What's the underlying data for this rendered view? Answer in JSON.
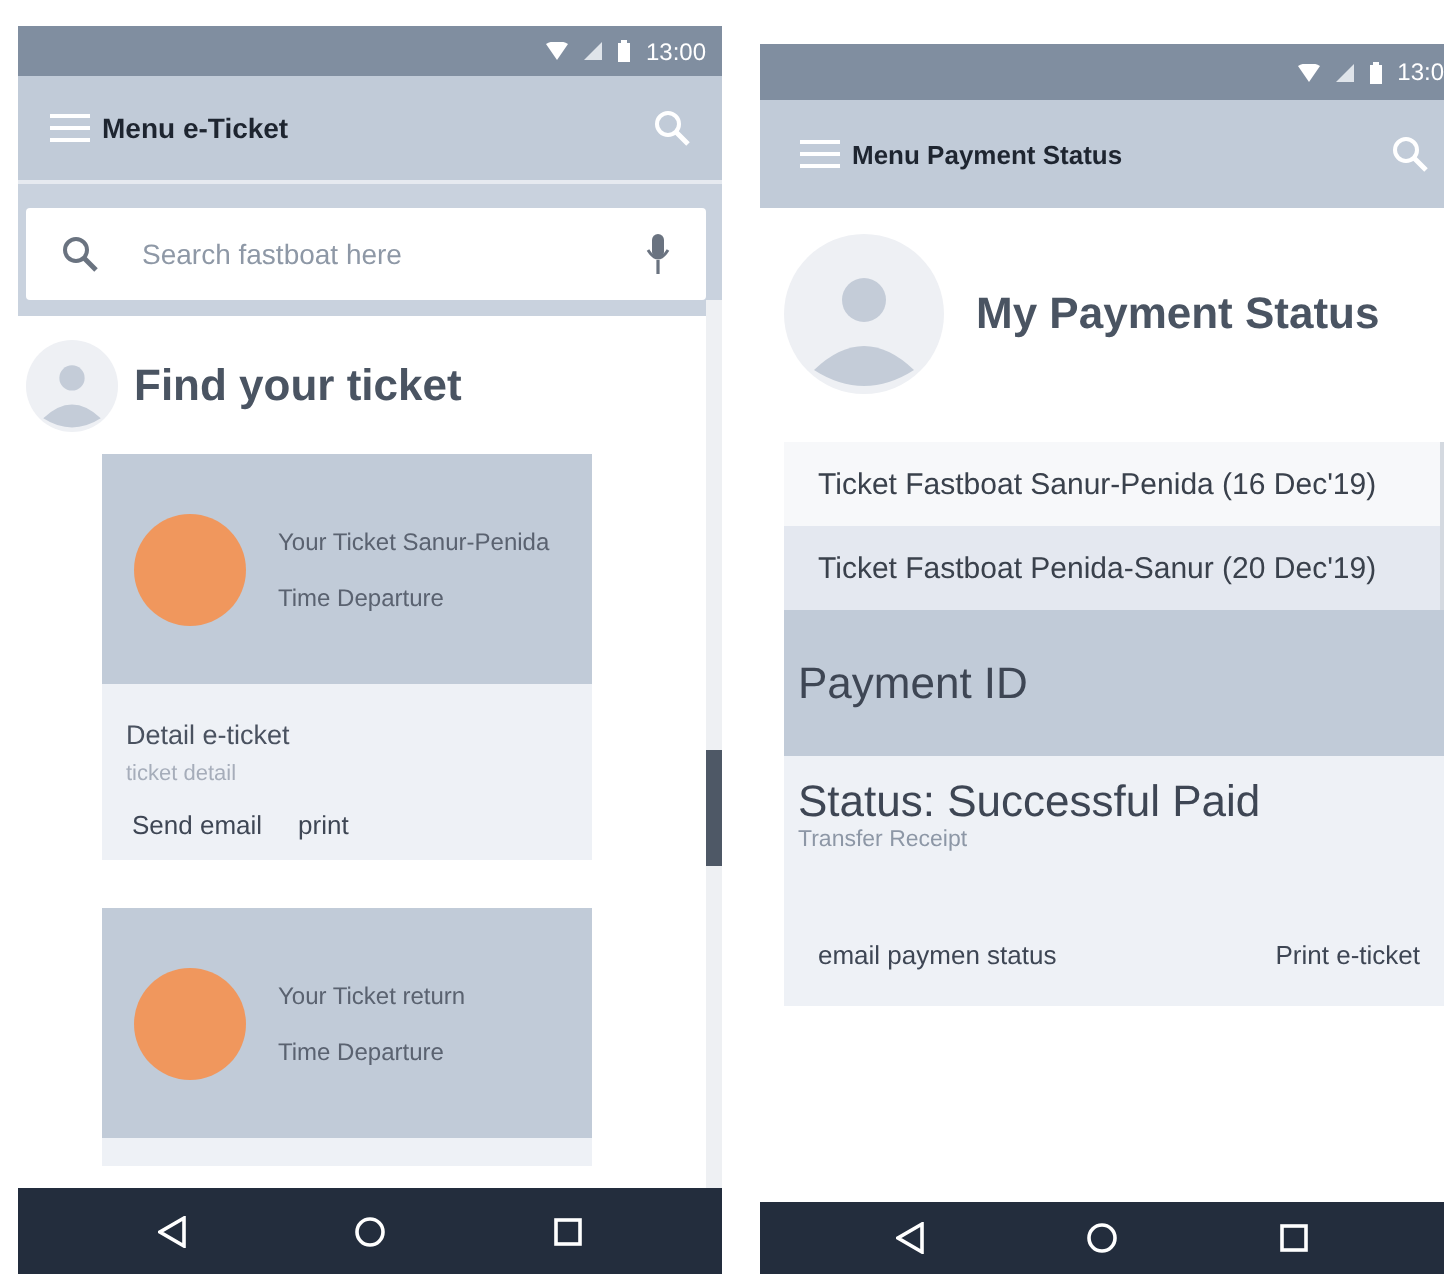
{
  "eticket_screen": {
    "status_bar": {
      "time": "13:00"
    },
    "app_bar": {
      "title": "Menu e-Ticket"
    },
    "search": {
      "placeholder": "Search fastboat here"
    },
    "heading": "Find your ticket",
    "tickets": [
      {
        "title": "Your Ticket Sanur-Penida",
        "subtitle": "Time Departure",
        "detail_title": "Detail e-ticket",
        "detail_subtitle": "ticket detail",
        "actions": [
          "Send email",
          "print"
        ]
      },
      {
        "title": "Your Ticket return",
        "subtitle": "Time Departure"
      }
    ]
  },
  "payment_screen": {
    "status_bar": {
      "time": "13:0"
    },
    "app_bar": {
      "title": "Menu Payment Status"
    },
    "heading": "My Payment Status",
    "tickets": [
      {
        "label": "Ticket Fastboat Sanur-Penida (16 Dec'19)",
        "selected": false
      },
      {
        "label": "Ticket Fastboat Penida-Sanur (20 Dec'19)",
        "selected": true
      }
    ],
    "payment_id": "Payment ID",
    "status": "Status: Successful Paid",
    "receipt": "Transfer Receipt",
    "actions": [
      "email paymen status",
      "Print e-ticket"
    ]
  }
}
